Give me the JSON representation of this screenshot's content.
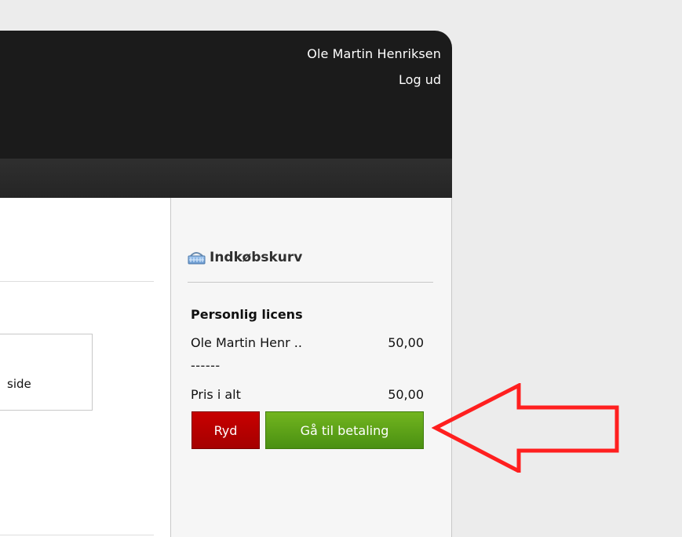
{
  "header": {
    "user_name": "Ole Martin Henriksen",
    "logout_label": "Log ud"
  },
  "content": {
    "box_text": "side"
  },
  "cart": {
    "title": "Indkøbskurv",
    "license_title": "Personlig licens",
    "item_label": "Ole Martin Henr ..",
    "item_amount": "50,00",
    "separator": "------",
    "total_label": "Pris i alt",
    "total_amount": "50,00",
    "clear_label": "Ryd",
    "checkout_label": "Gå til betaling"
  },
  "colors": {
    "header_bg": "#1b1b1b",
    "clear_button": "#b40000",
    "checkout_button": "#5fa719",
    "annotation_arrow": "#ff1f1f"
  },
  "icons": {
    "cart_icon": "basket-icon"
  }
}
